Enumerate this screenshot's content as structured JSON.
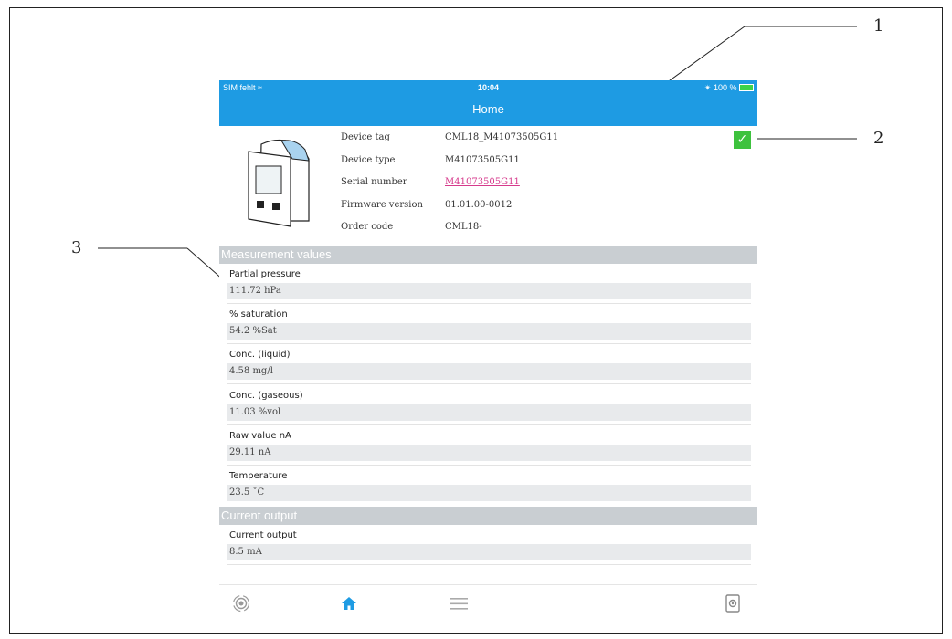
{
  "status_bar": {
    "carrier": "SIM fehlt",
    "time": "10:04",
    "battery": "100 %"
  },
  "nav": {
    "title": "Home"
  },
  "device_info": [
    {
      "label": "Device tag",
      "value": "CML18_M41073505G11"
    },
    {
      "label": "Device type",
      "value": "M41073505G11"
    },
    {
      "label": "Serial number",
      "value": "M41073505G11"
    },
    {
      "label": "Firmware version",
      "value": "01.01.00-0012"
    },
    {
      "label": "Order code",
      "value": "CML18-"
    }
  ],
  "sections": {
    "measurement": {
      "title": "Measurement values",
      "items": [
        {
          "name": "Partial pressure",
          "value": "111.72 hPa"
        },
        {
          "name": "% saturation",
          "value": "54.2 %Sat"
        },
        {
          "name": "Conc. (liquid)",
          "value": "4.58 mg/l"
        },
        {
          "name": "Conc. (gaseous)",
          "value": "11.03 %vol"
        },
        {
          "name": "Raw value nA",
          "value": "29.11 nA"
        },
        {
          "name": "Temperature",
          "value": "23.5 ˚C"
        }
      ]
    },
    "current_output": {
      "title": "Current output",
      "items": [
        {
          "name": "Current output",
          "value": "8.5 mA"
        }
      ]
    }
  },
  "callouts": {
    "c1": "1",
    "c2": "2",
    "c3": "3"
  },
  "tabs": [
    "connection-icon",
    "home-icon",
    "menu-icon",
    "device-icon"
  ],
  "colors": {
    "accent": "#1e9be3",
    "link": "#d63a8c",
    "ok": "#3ec23e",
    "section": "#c9ced2"
  }
}
